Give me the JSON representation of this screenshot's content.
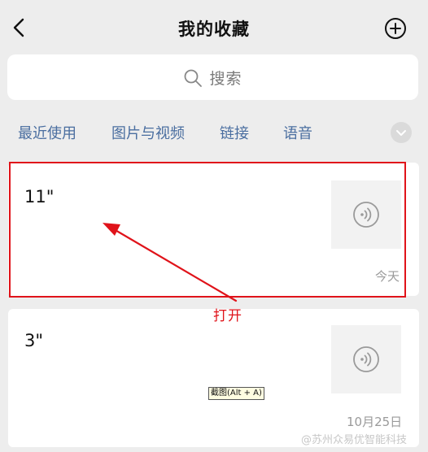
{
  "header": {
    "title": "我的收藏",
    "back_icon": "chevron-left-icon",
    "add_icon": "plus-circle-icon"
  },
  "search": {
    "placeholder": "搜索",
    "icon": "search-icon"
  },
  "filters": [
    {
      "label": "最近使用"
    },
    {
      "label": "图片与视频"
    },
    {
      "label": "链接"
    },
    {
      "label": "语音"
    }
  ],
  "filter_more_icon": "chevron-down-icon",
  "favorites": [
    {
      "title": "11\"",
      "type_icon": "voice-icon",
      "date": "今天"
    },
    {
      "title": "3\"",
      "type_icon": "voice-icon",
      "date": "10月25日"
    }
  ],
  "annotation": {
    "label": "打开",
    "color": "#e0131a"
  },
  "tooltip": "截图(Alt + A)",
  "watermark": "@苏州众易优智能科技",
  "colors": {
    "accent_link": "#4a6ea0",
    "background": "#ededed",
    "highlight": "#e0131a"
  }
}
